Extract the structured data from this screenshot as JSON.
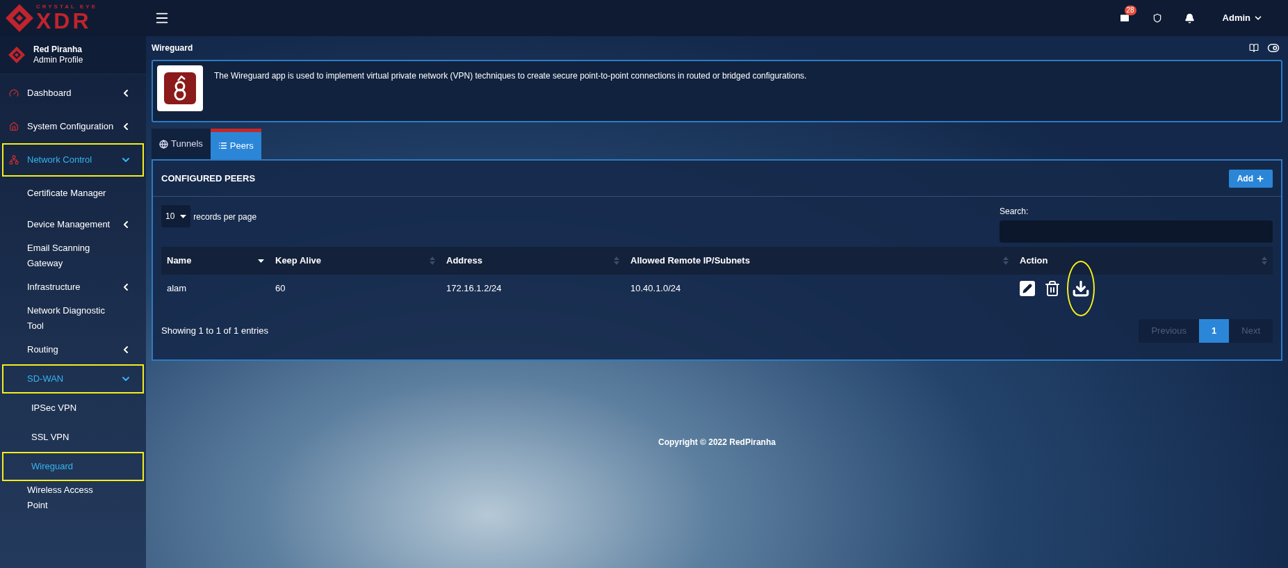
{
  "brand": {
    "tagline": "CRYSTAL EYE",
    "name": "XDR"
  },
  "topbar": {
    "mail_count": "28",
    "user": "Admin"
  },
  "profile": {
    "name": "Red Piranha",
    "role": "Admin Profile"
  },
  "sidebar": {
    "items": [
      {
        "label": "Dashboard",
        "expanded": false,
        "selected": false,
        "highlighted": false
      },
      {
        "label": "System Configuration",
        "expanded": false,
        "selected": false,
        "highlighted": false
      },
      {
        "label": "Network Control",
        "expanded": true,
        "selected": true,
        "highlighted": true,
        "children": [
          {
            "label": "Certificate Manager",
            "selected": false,
            "highlighted": false
          },
          {
            "label": "Device Management",
            "expanded": false,
            "selected": false,
            "highlighted": false
          },
          {
            "label": "Email Scanning Gateway",
            "selected": false,
            "highlighted": false
          },
          {
            "label": "Infrastructure",
            "expanded": false,
            "selected": false,
            "highlighted": false
          },
          {
            "label": "Network Diagnostic Tool",
            "selected": false,
            "highlighted": false
          },
          {
            "label": "Routing",
            "expanded": false,
            "selected": false,
            "highlighted": false
          },
          {
            "label": "SD-WAN",
            "expanded": true,
            "selected": true,
            "highlighted": true,
            "children": [
              {
                "label": "IPSec VPN",
                "selected": false,
                "highlighted": false
              },
              {
                "label": "SSL VPN",
                "selected": false,
                "highlighted": false
              },
              {
                "label": "Wireguard",
                "selected": true,
                "highlighted": true
              }
            ]
          },
          {
            "label": "Wireless Access Point",
            "selected": false,
            "highlighted": false
          }
        ]
      }
    ]
  },
  "page": {
    "title": "Wireguard"
  },
  "info": {
    "text": "The Wireguard app is used to implement virtual private network (VPN) techniques to create secure point-to-point connections in routed or bridged configurations."
  },
  "tabs": [
    {
      "label": "Tunnels",
      "selected": false
    },
    {
      "label": "Peers",
      "selected": true
    }
  ],
  "panel": {
    "title": "CONFIGURED PEERS",
    "add_button": "Add"
  },
  "length": {
    "value": "10",
    "label": "records per page"
  },
  "search": {
    "label": "Search:"
  },
  "table": {
    "columns": [
      {
        "label": "Name",
        "sorted": true
      },
      {
        "label": "Keep Alive",
        "sorted": false
      },
      {
        "label": "Address",
        "sorted": false
      },
      {
        "label": "Allowed Remote IP/Subnets",
        "sorted": false
      },
      {
        "label": "Action",
        "sorted": false
      }
    ],
    "rows": [
      {
        "cells": [
          "alam",
          "60",
          "172.16.1.2/24",
          "10.40.1.0/24"
        ],
        "actions": [
          {
            "kind": "edit",
            "highlighted": false
          },
          {
            "kind": "delete",
            "highlighted": false
          },
          {
            "kind": "download",
            "highlighted": true
          }
        ]
      }
    ]
  },
  "summary": "Showing 1 to 1 of 1 entries",
  "pagination": [
    {
      "label": "Previous",
      "selected": false,
      "disabled": true
    },
    {
      "label": "1",
      "selected": true,
      "disabled": false
    },
    {
      "label": "Next",
      "selected": false,
      "disabled": true
    }
  ],
  "footer": "Copyright © 2022 RedPiranha"
}
